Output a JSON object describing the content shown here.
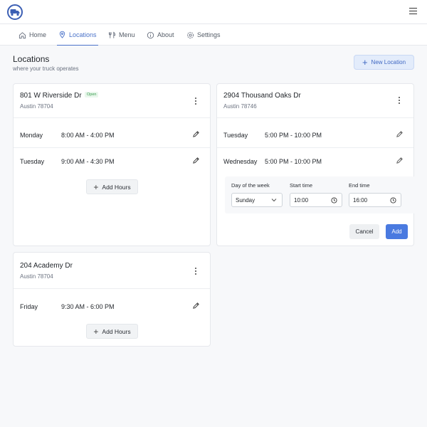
{
  "header": {
    "logo_icon": "truck-icon",
    "menu_icon": "hamburger-icon",
    "accent": "#4a72c9"
  },
  "nav": {
    "items": [
      {
        "label": "Home",
        "icon": "home-icon"
      },
      {
        "label": "Locations",
        "icon": "map-pin-icon",
        "active": true
      },
      {
        "label": "Menu",
        "icon": "utensils-icon"
      },
      {
        "label": "About",
        "icon": "info-icon"
      },
      {
        "label": "Settings",
        "icon": "gear-icon"
      }
    ]
  },
  "page": {
    "title": "Locations",
    "subtitle": "where your truck operates",
    "new_location_label": "New Location"
  },
  "locations": [
    {
      "address": "801 W Riverside Dr",
      "badge": "Open",
      "city_zip": "Austin 78704",
      "hours": [
        {
          "day": "Monday",
          "time": "8:00 AM - 4:00 PM"
        },
        {
          "day": "Tuesday",
          "time": "9:00 AM - 4:30 PM"
        }
      ],
      "add_hours_label": "Add Hours"
    },
    {
      "address": "2904 Thousand Oaks Dr",
      "city_zip": "Austin 78746",
      "hours": [
        {
          "day": "Tuesday",
          "time": "5:00 PM - 10:00 PM"
        },
        {
          "day": "Wednesday",
          "time": "5:00 PM - 10:00 PM"
        }
      ],
      "form": {
        "day_label": "Day of the week",
        "day_value": "Sunday",
        "start_label": "Start time",
        "start_value": "10:00",
        "end_label": "End time",
        "end_value": "16:00",
        "cancel_label": "Cancel",
        "add_label": "Add"
      }
    },
    {
      "address": "204 Academy Dr",
      "city_zip": "Austin 78704",
      "hours": [
        {
          "day": "Friday",
          "time": "9:30 AM - 6:00 PM"
        }
      ],
      "add_hours_label": "Add Hours"
    }
  ]
}
